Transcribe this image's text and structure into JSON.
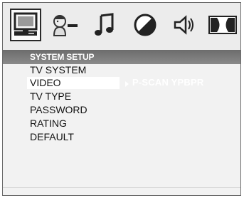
{
  "header": {
    "title": "SYSTEM SETUP"
  },
  "tabs": [
    {
      "icon": "monitor-icon",
      "selected": true
    },
    {
      "icon": "person-language-icon",
      "selected": false
    },
    {
      "icon": "music-note-icon",
      "selected": false
    },
    {
      "icon": "half-circle-icon",
      "selected": false
    },
    {
      "icon": "speaker-icon",
      "selected": false
    },
    {
      "icon": "dolby-icon",
      "selected": false
    }
  ],
  "menu": {
    "items": [
      {
        "label": "TV SYSTEM"
      },
      {
        "label": "VIDEO",
        "highlighted": true
      },
      {
        "label": "TV TYPE"
      },
      {
        "label": "PASSWORD"
      },
      {
        "label": "RATING"
      },
      {
        "label": "DEFAULT"
      }
    ]
  },
  "submenu": {
    "option": "P-SCAN YPBPR"
  },
  "colors": {
    "header": "#7a7a7a",
    "panel": "#f2f2f2",
    "text": "#111111",
    "highlight_text": "#ffffff"
  }
}
